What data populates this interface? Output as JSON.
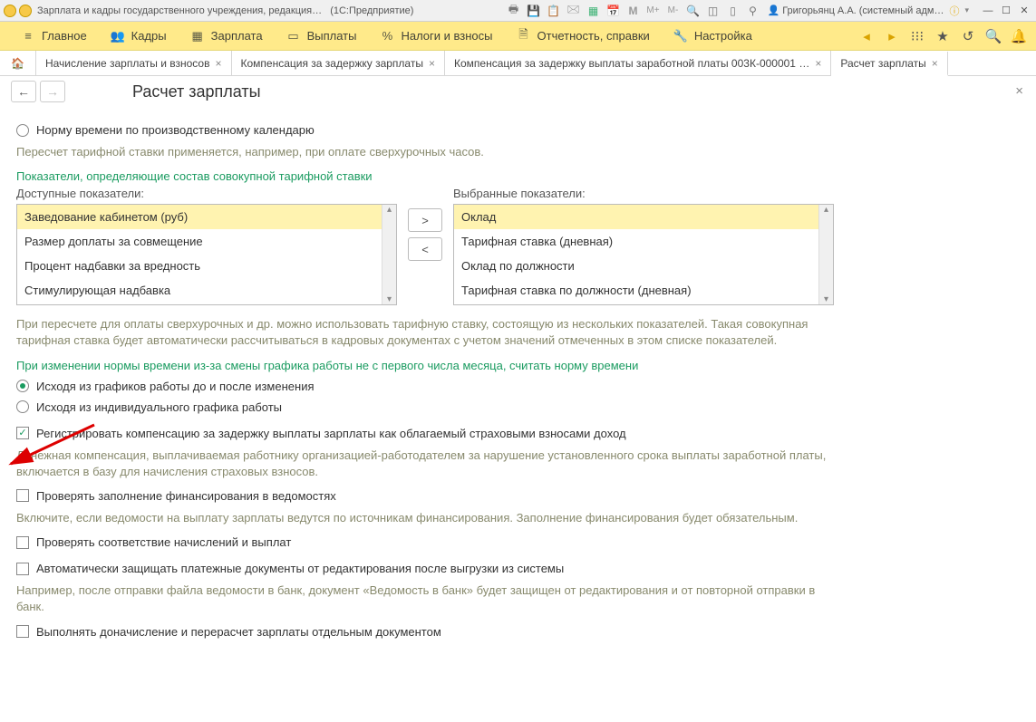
{
  "titlebar": {
    "app_title": "Зарплата и кадры государственного учреждения, редакция…",
    "suffix": "(1С:Предприятие)",
    "user": "Григорьянц А.А. (системный адм…",
    "icons": [
      "print",
      "save",
      "attach",
      "mail",
      "calc",
      "calendar",
      "M",
      "M+",
      "M-",
      "zoom-in",
      "clipboard",
      "book",
      "key"
    ]
  },
  "mainmenu": {
    "items": [
      {
        "label": "Главное",
        "icon": "list"
      },
      {
        "label": "Кадры",
        "icon": "people"
      },
      {
        "label": "Зарплата",
        "icon": "calc"
      },
      {
        "label": "Выплаты",
        "icon": "card"
      },
      {
        "label": "Налоги и взносы",
        "icon": "percent"
      },
      {
        "label": "Отчетность, справки",
        "icon": "doc"
      },
      {
        "label": "Настройка",
        "icon": "wrench"
      }
    ]
  },
  "doctabs": [
    {
      "label": "Начисление зарплаты и взносов"
    },
    {
      "label": "Компенсация за задержку зарплаты"
    },
    {
      "label": "Компенсация за задержку выплаты заработной платы 003К-000001 …"
    },
    {
      "label": "Расчет зарплаты",
      "active": true
    }
  ],
  "page": {
    "title": "Расчет зарплаты",
    "radio_time_norm": "Норму времени по производственному календарю",
    "hint_recalc": "Пересчет тарифной ставки применяется, например, при оплате сверхурочных часов.",
    "sect_indicators": "Показатели, определяющие состав совокупной тарифной ставки",
    "available_label": "Доступные показатели:",
    "selected_label": "Выбранные показатели:",
    "available": [
      "Заведование кабинетом (руб)",
      "Размер доплаты за совмещение",
      "Процент надбавки за вредность",
      "Стимулирующая надбавка"
    ],
    "selected": [
      "Оклад",
      "Тарифная ставка (дневная)",
      "Оклад по должности",
      "Тарифная ставка по должности (дневная)"
    ],
    "hint_overtime": "При пересчете для оплаты сверхурочных и др. можно использовать тарифную ставку, состоящую из нескольких показателей. Такая совокупная тарифная ставка будет автоматически рассчитываться в кадровых документах с учетом значений отмеченных в этом списке показателей.",
    "sect_norm_change": "При изменении нормы времени из-за смены графика работы не с первого числа месяца, считать норму времени",
    "radio_graph_before_after": "Исходя из графиков работы до и после изменения",
    "radio_individual": "Исходя из индивидуального графика работы",
    "chk_comp_label": "Регистрировать компенсацию за задержку выплаты зарплаты как облагаемый страховыми взносами доход",
    "hint_comp": "Денежная компенсация, выплачиваемая работнику организацией-работодателем за нарушение установленного срока выплаты заработной платы, включается в базу для начисления страховых взносов.",
    "chk_fin": "Проверять заполнение финансирования в ведомостях",
    "hint_fin": "Включите, если ведомости на выплату зарплаты ведутся по источникам финансирования. Заполнение финансирования будет обязательным.",
    "chk_match": "Проверять соответствие начислений и выплат",
    "chk_protect": "Автоматически защищать платежные документы от редактирования после выгрузки из системы",
    "hint_protect": "Например, после отправки файла ведомости в банк, документ «Ведомость в банк» будет защищен от редактирования и от повторной отправки в банк.",
    "chk_recalc_doc": "Выполнять доначисление и перерасчет зарплаты отдельным документом",
    "move_right": ">",
    "move_left": "<"
  }
}
